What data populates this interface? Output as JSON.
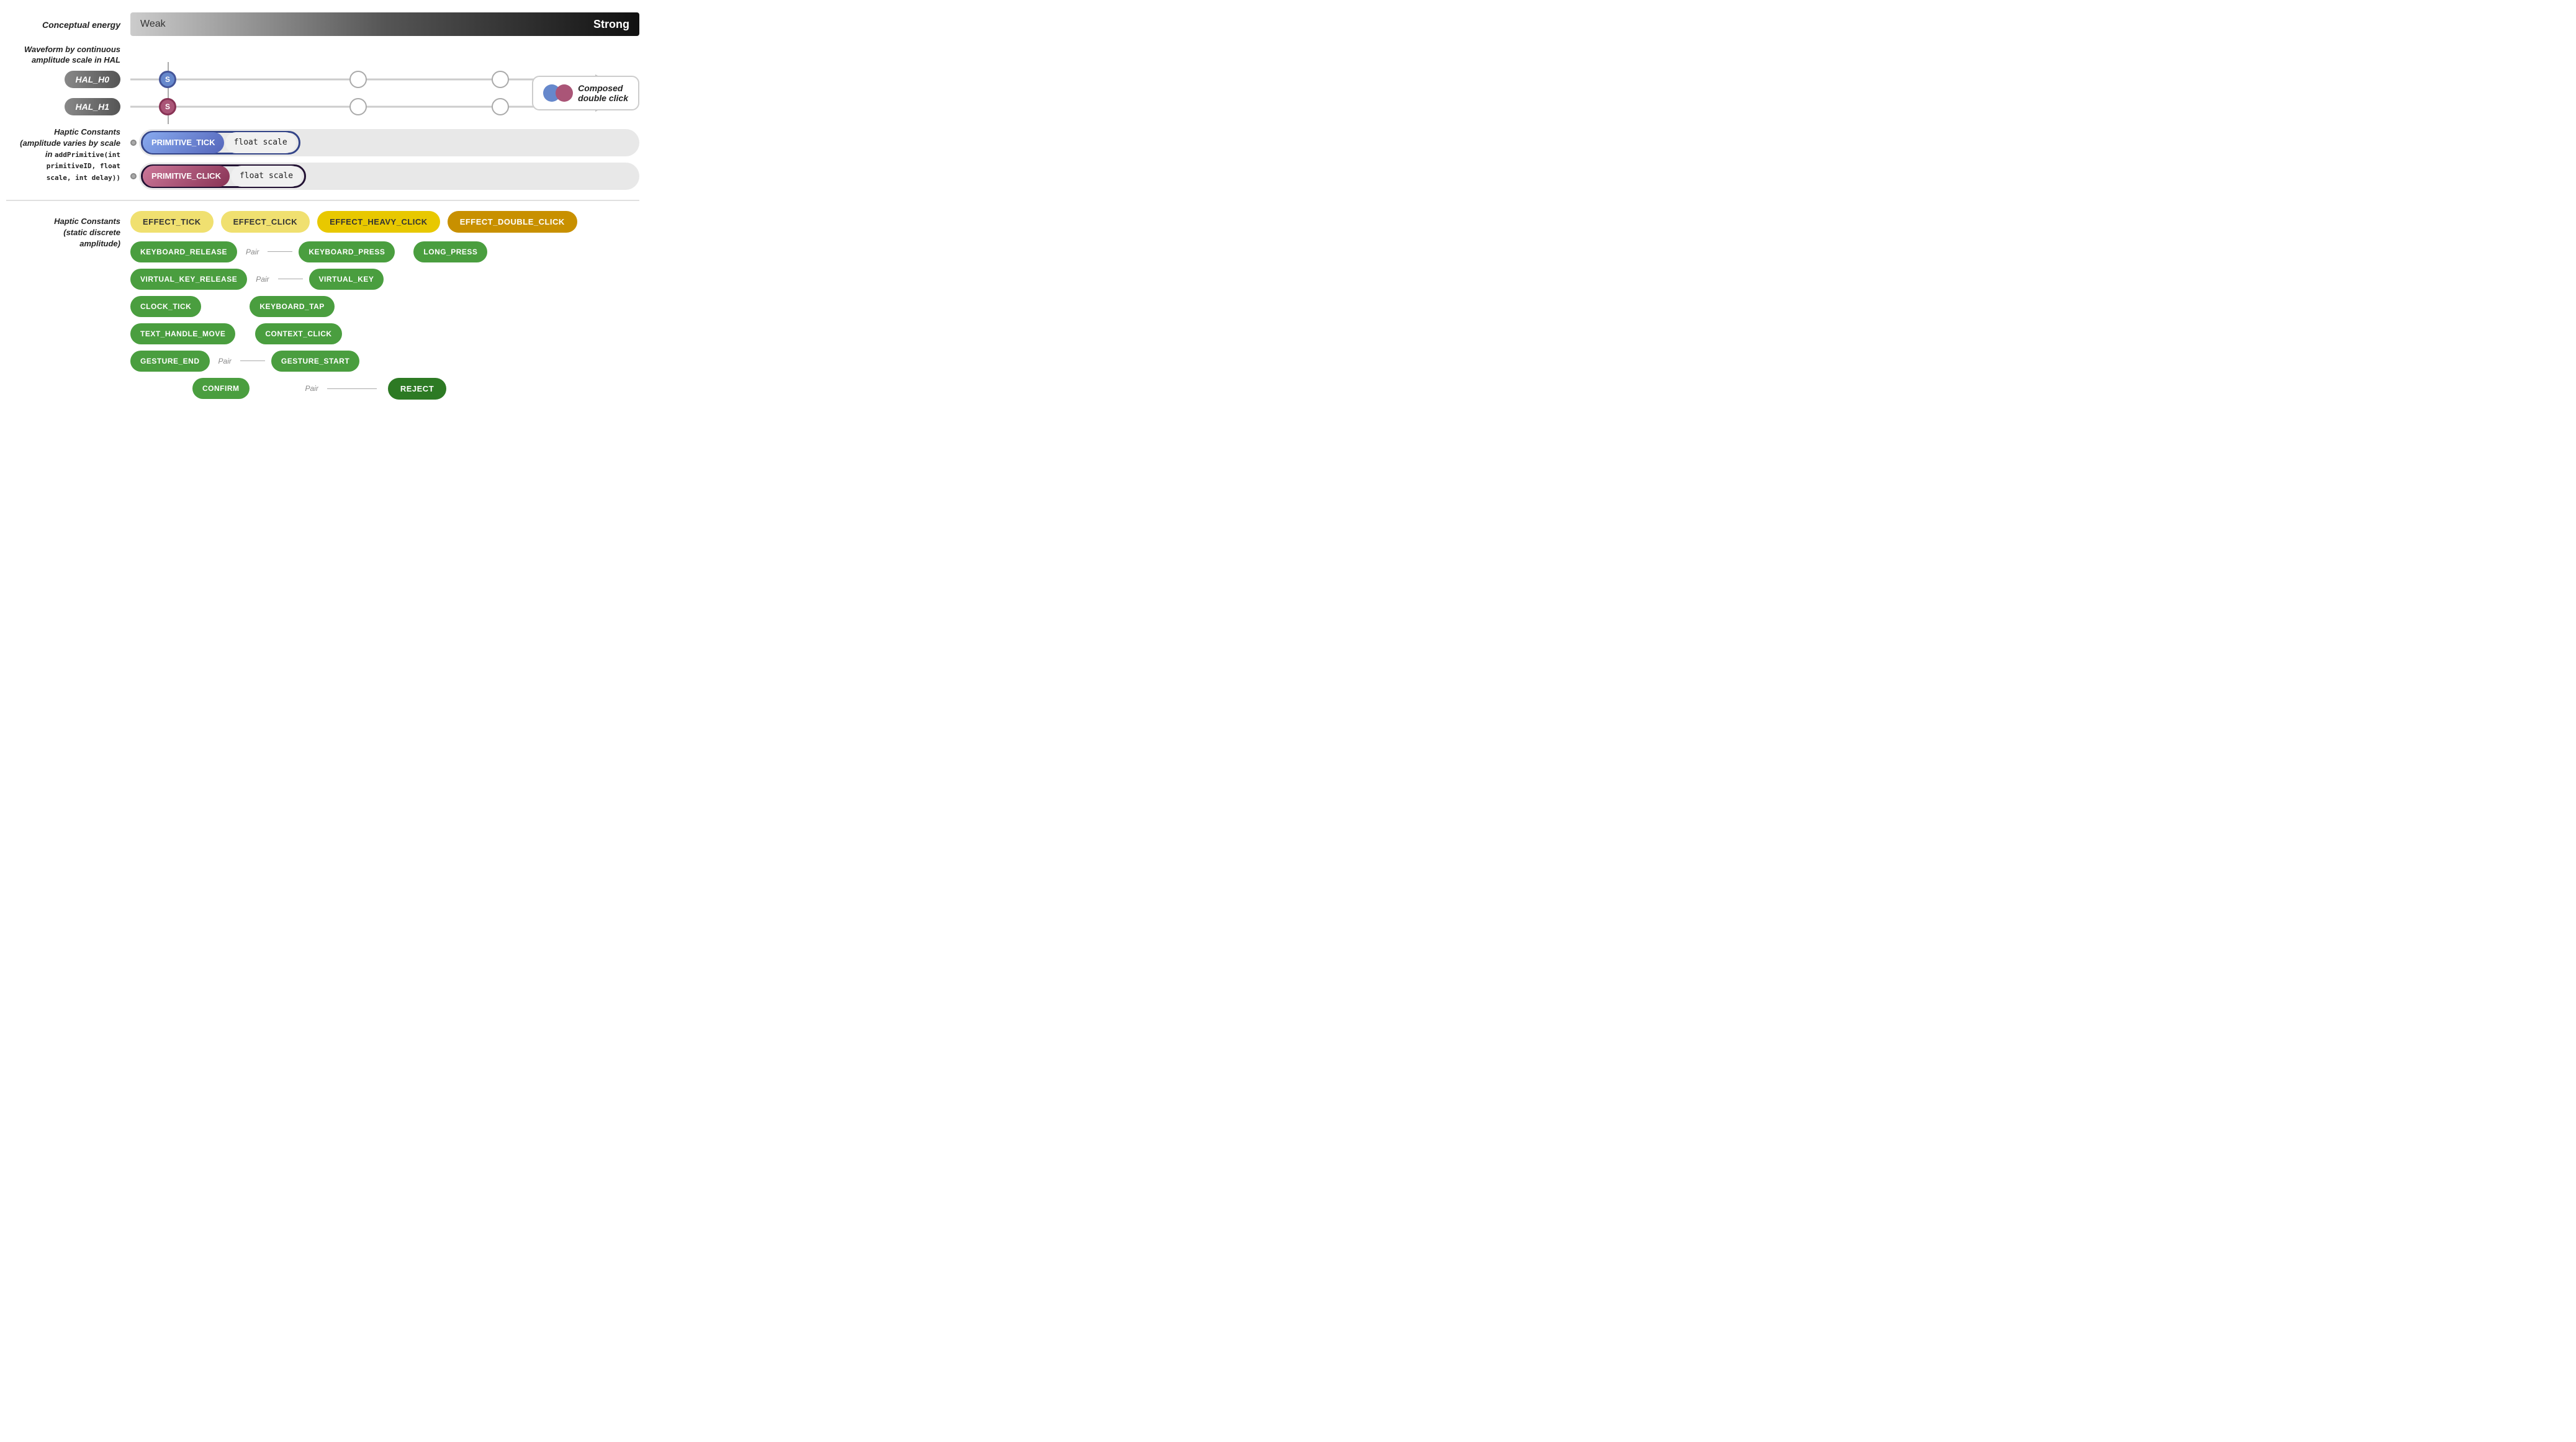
{
  "conceptual_energy": {
    "label": "Conceptual energy",
    "weak": "Weak",
    "strong": "Strong"
  },
  "waveform_section": {
    "label": "Waveform by continuous\namplitude scale in HAL"
  },
  "hal_sliders": [
    {
      "id": "hal_h0",
      "badge": "HAL_H0",
      "circle_label": "S",
      "circle_type": "blue",
      "mid1_pos": "45%",
      "mid2_pos": "75%"
    },
    {
      "id": "hal_h1",
      "badge": "HAL_H1",
      "circle_label": "S",
      "circle_type": "pink",
      "mid1_pos": "45%",
      "mid2_pos": "75%"
    }
  ],
  "composed_legend": {
    "text": "Composed\ndouble click"
  },
  "primitive_section": {
    "label": "Haptic Constants\n(amplitude varies by scale\nin addPrimitive(int\nprimitiveID, float\nscale, int delay))",
    "bars": [
      {
        "name": "PRIMITIVE_TICK",
        "scale": "float scale",
        "type": "blue"
      },
      {
        "name": "PRIMITIVE_CLICK",
        "scale": "float scale",
        "type": "pink"
      }
    ]
  },
  "effects": [
    {
      "id": "effect_tick",
      "label": "EFFECT_TICK",
      "style": "yellow-light"
    },
    {
      "id": "effect_click",
      "label": "EFFECT_CLICK",
      "style": "yellow-light"
    },
    {
      "id": "effect_heavy_click",
      "label": "EFFECT_HEAVY_CLICK",
      "style": "yellow-mid"
    },
    {
      "id": "effect_double_click",
      "label": "EFFECT_DOUBLE_CLICK",
      "style": "yellow-dark"
    }
  ],
  "discrete_section": {
    "label": "Haptic Constants\n(static discrete\namplitude)",
    "rows": [
      {
        "cols": [
          {
            "label": "KEYBOARD_RELEASE",
            "type": "green"
          },
          {
            "pair": true
          },
          {
            "label": "KEYBOARD_PRESS",
            "type": "green"
          },
          {
            "label": "LONG_PRESS",
            "type": "green"
          }
        ]
      },
      {
        "cols": [
          {
            "label": "VIRTUAL_KEY_RELEASE",
            "type": "green"
          },
          {
            "pair": true
          },
          {
            "label": "VIRTUAL_KEY",
            "type": "green"
          }
        ]
      },
      {
        "cols": [
          {
            "label": "CLOCK_TICK",
            "type": "green"
          },
          {
            "label": "KEYBOARD_TAP",
            "type": "green"
          }
        ]
      },
      {
        "cols": [
          {
            "label": "TEXT_HANDLE_MOVE",
            "type": "green"
          },
          {
            "label": "CONTEXT_CLICK",
            "type": "green"
          }
        ]
      },
      {
        "cols": [
          {
            "label": "GESTURE_END",
            "type": "green"
          },
          {
            "pair": true
          },
          {
            "label": "GESTURE_START",
            "type": "green"
          }
        ]
      },
      {
        "cols": [
          {
            "label": "CONFIRM",
            "type": "green"
          },
          {
            "pair_right": true
          },
          {
            "label": "REJECT",
            "type": "green-dark"
          }
        ]
      }
    ]
  }
}
